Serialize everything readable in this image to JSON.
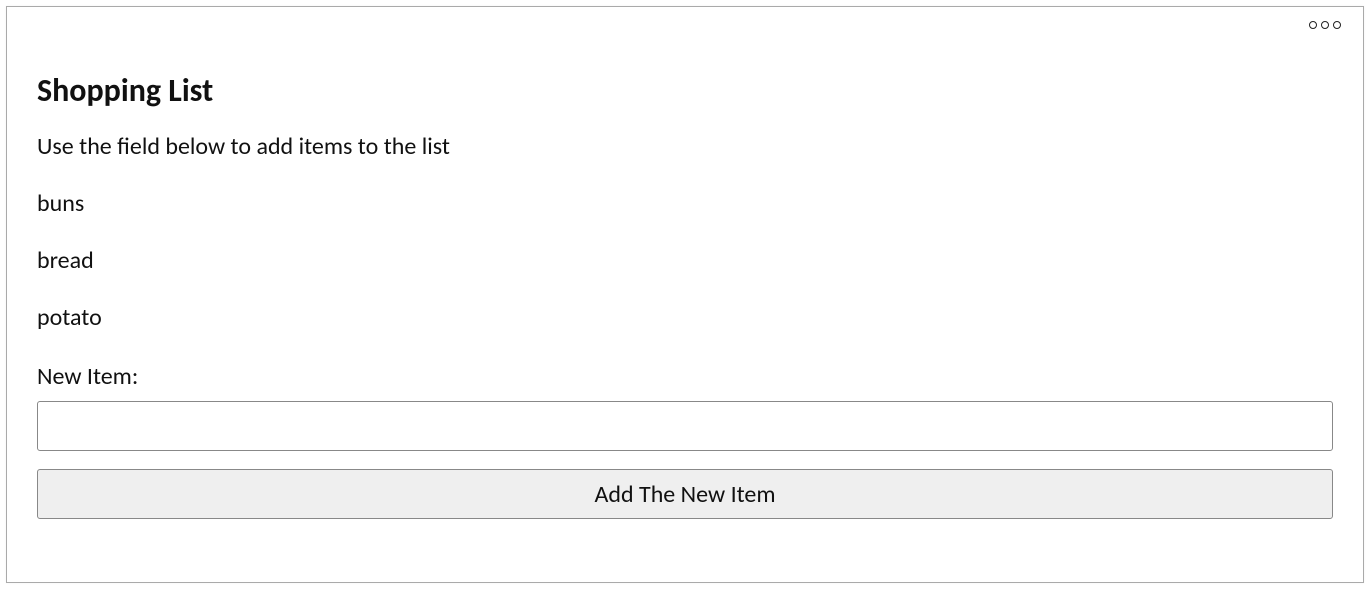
{
  "header": {
    "title": "Shopping List",
    "subtitle": "Use the field below to add items to the list"
  },
  "items": [
    "buns",
    "bread",
    "potato"
  ],
  "form": {
    "label": "New Item:",
    "input_value": "",
    "button_label": "Add The New Item"
  }
}
